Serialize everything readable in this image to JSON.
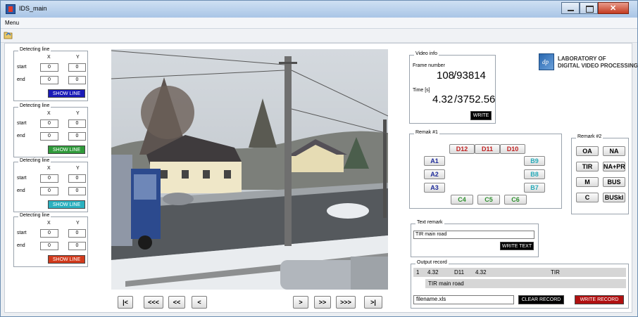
{
  "window": {
    "title": "IDS_main",
    "menu": "Menu"
  },
  "detecting_lines": [
    {
      "label": "Detecting line",
      "x_label": "X",
      "y_label": "Y",
      "start_label": "start",
      "end_label": "end",
      "start_x": "0",
      "start_y": "0",
      "end_x": "0",
      "end_y": "0",
      "button": "SHOW LINE",
      "button_color": "#1a1ab8"
    },
    {
      "label": "Detecting line",
      "x_label": "X",
      "y_label": "Y",
      "start_label": "start",
      "end_label": "end",
      "start_x": "0",
      "start_y": "0",
      "end_x": "0",
      "end_y": "0",
      "button": "SHOW LINE",
      "button_color": "#2f9a3a"
    },
    {
      "label": "Detecting line",
      "x_label": "X",
      "y_label": "Y",
      "start_label": "start",
      "end_label": "end",
      "start_x": "0",
      "start_y": "0",
      "end_x": "0",
      "end_y": "0",
      "button": "SHOW LINE",
      "button_color": "#2ab1c0"
    },
    {
      "label": "Detecting line",
      "x_label": "X",
      "y_label": "Y",
      "start_label": "start",
      "end_label": "end",
      "start_x": "0",
      "start_y": "0",
      "end_x": "0",
      "end_y": "0",
      "button": "SHOW LINE",
      "button_color": "#d23a1c"
    }
  ],
  "navigation": {
    "first": "|<",
    "back3": "<<<",
    "back2": "<<",
    "back1": "<",
    "fwd1": ">",
    "fwd2": ">>",
    "fwd3": ">>>",
    "last": ">|"
  },
  "video_info": {
    "label": "Video info",
    "frame_label": "Frame number",
    "frame_current": "108",
    "frame_total": "/93814",
    "time_label": "Time  [s]",
    "time_current": "4.32",
    "time_total": "/3752.56",
    "write_button": "WRITE"
  },
  "lab": {
    "line1": "LABORATORY OF",
    "line2": "DIGITAL VIDEO PROCESSING",
    "logo_text": "dp"
  },
  "remark1": {
    "label": "Remak #1",
    "buttons": [
      {
        "label": "D12",
        "color": "red"
      },
      {
        "label": "D11",
        "color": "red"
      },
      {
        "label": "D10",
        "color": "red"
      },
      {
        "label": "A1",
        "color": "blue"
      },
      {
        "label": "A2",
        "color": "blue"
      },
      {
        "label": "A3",
        "color": "blue"
      },
      {
        "label": "B9",
        "color": "cyan"
      },
      {
        "label": "B8",
        "color": "cyan"
      },
      {
        "label": "B7",
        "color": "cyan"
      },
      {
        "label": "C4",
        "color": "green"
      },
      {
        "label": "C5",
        "color": "green"
      },
      {
        "label": "C6",
        "color": "green"
      }
    ]
  },
  "remark2": {
    "label": "Remark #2",
    "buttons": [
      "OA",
      "NA",
      "TIR",
      "NA+PR",
      "M",
      "BUS",
      "C",
      "BUSkl"
    ]
  },
  "text_remark": {
    "label": "Text remark",
    "value": "TIR main road",
    "button": "WRITE TEXT"
  },
  "output_record": {
    "label": "Output record",
    "index": "1",
    "time": "4.32",
    "remark1": "D11",
    "time2": "4.32",
    "remark2": "TIR",
    "text": "TIR main road",
    "filename": "filename.xls",
    "clear_button": "CLEAR RECORD",
    "write_button": "WRITE RECORD"
  }
}
